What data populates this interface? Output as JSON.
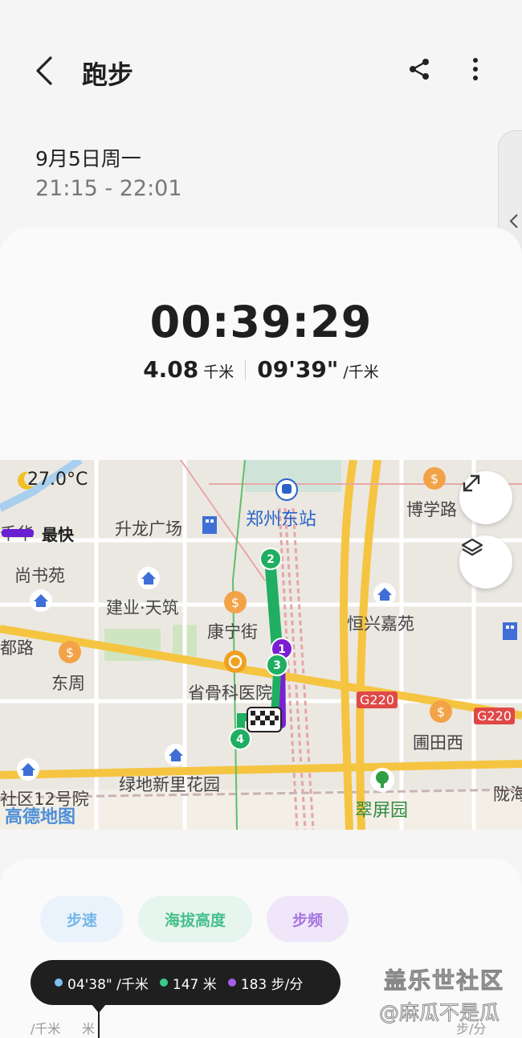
{
  "header": {
    "title": "跑步"
  },
  "session": {
    "date": "9月5日周一",
    "time_range": "21:15 - 22:01"
  },
  "summary": {
    "duration": "00:39:29",
    "distance_value": "4.08",
    "distance_unit": "千米",
    "pace_value": "09'39\"",
    "pace_unit": "/千米"
  },
  "map": {
    "temperature": "27.0°C",
    "legend_fastest": "最快",
    "legend_partial": "千华",
    "labels": {
      "zhengzhou_east": "郑州东站",
      "boxuelu": "博学路",
      "shenglong": "升龙广场",
      "shangshuyuan": "尚书苑",
      "jianye": "建业·天筑",
      "kangning": "康宁街",
      "hengxing": "恒兴嘉苑",
      "dulu": "都路",
      "dongzhou": "东周",
      "shenggu": "省骨科医院",
      "putianxi": "圃田西",
      "lvdi": "绿地新里花园",
      "shequ12": "社区12号院",
      "cuipingyuan": "翠屏园",
      "longhai": "陇海",
      "g220_a": "G220",
      "g220_b": "G220"
    },
    "markers": [
      "1",
      "2",
      "3",
      "4"
    ],
    "provider": "高德地图"
  },
  "chips": {
    "pace": "步速",
    "altitude": "海拔高度",
    "cadence": "步频"
  },
  "tooltip": {
    "pace": "04'38\" /千米",
    "altitude": "147 米",
    "cadence": "183 步/分"
  },
  "axis": {
    "left_unit": "/千米",
    "mid_unit": "米",
    "right_unit": "步/分"
  },
  "watermark": {
    "line1": "盖乐世社区",
    "line2": "@麻瓜不是瓜"
  },
  "colors": {
    "route_green": "#1fae62",
    "route_purple": "#7a1fd1",
    "pace_dot": "#7cc1ef",
    "altitude_dot": "#3cc98c",
    "cadence_dot": "#a260ec"
  }
}
